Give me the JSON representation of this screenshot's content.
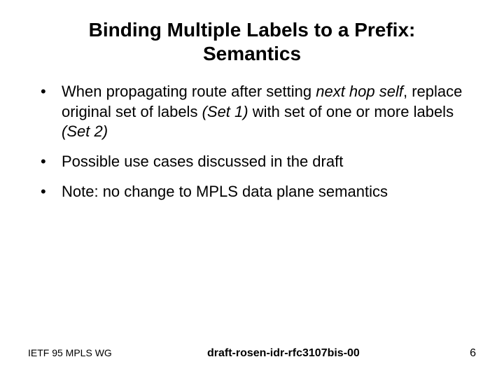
{
  "title_line1": "Binding Multiple Labels to a Prefix:",
  "title_line2": "Semantics",
  "bullets": [
    {
      "pre": "When propagating route after setting ",
      "em1": "next hop self",
      "mid": ", replace original set of labels ",
      "em2": "(Set 1)",
      "mid2": " with set of one or more labels ",
      "em3": "(Set 2)"
    },
    {
      "plain": "Possible use cases discussed in the draft"
    },
    {
      "plain": "Note: no change to MPLS data plane semantics"
    }
  ],
  "footer": {
    "left": "IETF 95 MPLS WG",
    "center": "draft-rosen-idr-rfc3107bis-00",
    "right": "6"
  }
}
